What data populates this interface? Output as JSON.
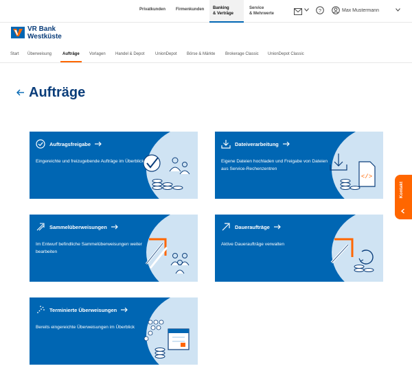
{
  "topnav": {
    "privat": "Privatkunden",
    "firmen": "Firmenkunden",
    "banking_line1": "Banking",
    "banking_line2": "& Verträge",
    "service_line1": "Service",
    "service_line2": "& Mehrwerte",
    "user_name": "Max Mustermann"
  },
  "logo": {
    "line1": "VR Bank",
    "line2": "Westküste"
  },
  "mainmenu": {
    "items": [
      "Start",
      "Überweisung",
      "Aufträge",
      "Vorlagen",
      "Handel & Depot",
      "UnionDepot",
      "Börse & Märkte",
      "Brokerage Classic",
      "UnionDepot Classic"
    ],
    "active": "Aufträge"
  },
  "page": {
    "title": "Aufträge"
  },
  "cards": [
    {
      "title": "Auftragsfreigabe",
      "desc": "Eingereichte und freizugebende Aufträge im Überblick",
      "icon": "check-circle-icon"
    },
    {
      "title": "Dateiverarbeitung",
      "desc": "Eigene Dateien hochladen und Freigabe von Dateien aus Service-Rechenzentren",
      "icon": "download-icon"
    },
    {
      "title": "Sammelüberweisungen",
      "desc": "Im Entwurf befindliche Sammelüberweisungen weiter bearbeiten",
      "icon": "multi-arrow-icon"
    },
    {
      "title": "Daueraufträge",
      "desc": "Aktive Daueraufträge verwalten",
      "icon": "arrow-icon"
    },
    {
      "title": "Terminierte Überweisungen",
      "desc": "Bereits eingereichte Überweisungen im Überblick",
      "icon": "dotted-arrow-icon"
    }
  ],
  "kontakt": {
    "label": "Kontakt"
  },
  "colors": {
    "brand_blue": "#0066b3",
    "navy": "#0a3d7a",
    "orange": "#ff6600",
    "light_blue": "#cfe3f3"
  }
}
